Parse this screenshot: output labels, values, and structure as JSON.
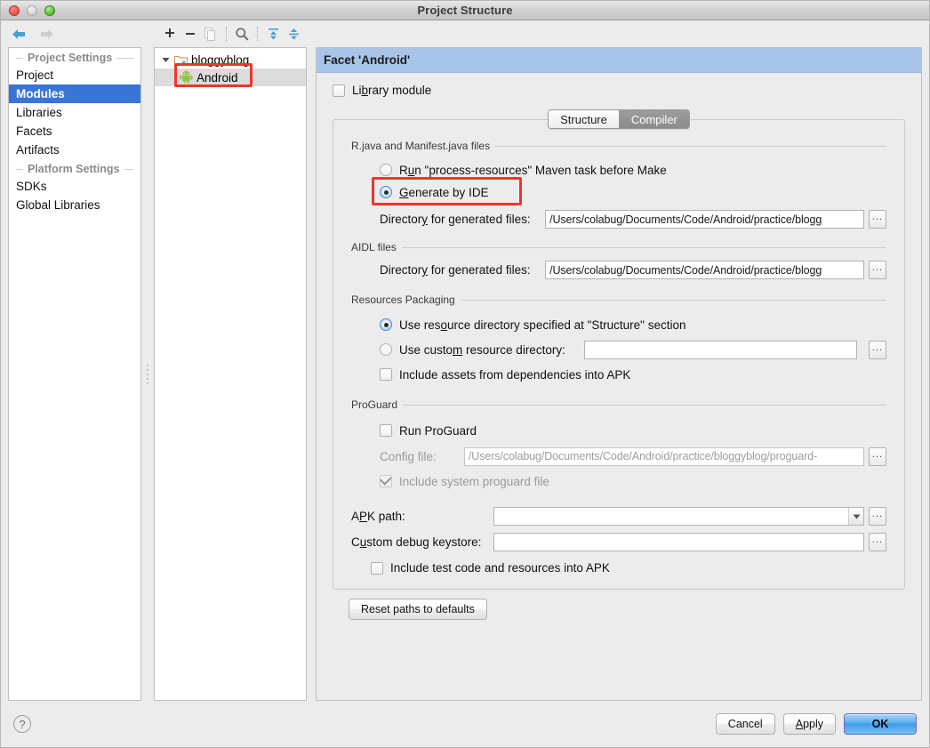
{
  "window": {
    "title": "Project Structure",
    "traffic_lights": [
      "close-red",
      "minimize-yellow",
      "zoom-green"
    ]
  },
  "toolbar": {
    "nav_back": "back-arrow-icon",
    "nav_forward": "forward-arrow-icon",
    "add": "+",
    "remove": "−",
    "copy": "copy-icon",
    "search": "search-icon",
    "expand_all": "expand-all-icon",
    "collapse_all": "collapse-all-icon"
  },
  "sidebar": {
    "groups": [
      {
        "title": "Project Settings",
        "items": [
          {
            "label": "Project",
            "selected": false
          },
          {
            "label": "Modules",
            "selected": true
          },
          {
            "label": "Libraries",
            "selected": false
          },
          {
            "label": "Facets",
            "selected": false
          },
          {
            "label": "Artifacts",
            "selected": false
          }
        ]
      },
      {
        "title": "Platform Settings",
        "items": [
          {
            "label": "SDKs",
            "selected": false
          },
          {
            "label": "Global Libraries",
            "selected": false
          }
        ]
      }
    ]
  },
  "tree": {
    "root": {
      "label": "bloggyblog",
      "expanded": true,
      "icon": "folder-icon"
    },
    "child": {
      "label": "Android",
      "icon": "android-icon",
      "selected": true,
      "highlighted": true
    }
  },
  "main": {
    "header_title": "Facet 'Android'",
    "library_module": {
      "label": "Library module",
      "mnemonic": "b",
      "checked": false
    },
    "tabs": [
      {
        "label": "Structure",
        "active": false
      },
      {
        "label": "Compiler",
        "active": true
      }
    ],
    "sections": [
      {
        "title": "R.java and Manifest.java files",
        "radios": [
          {
            "label": "Run \"process-resources\" Maven task before Make",
            "mnemonic": "u",
            "selected": false,
            "highlighted": false
          },
          {
            "label": "Generate by IDE",
            "mnemonic": "G",
            "selected": true,
            "highlighted": true
          }
        ],
        "field_label": "Directory for generated files:",
        "field_mnemonic": "y",
        "field_value": "/Users/colabug/Documents/Code/Android/practice/blogg",
        "browse": "..."
      },
      {
        "title": "AIDL files",
        "field_label": "Directory for generated files:",
        "field_mnemonic": "y",
        "field_value": "/Users/colabug/Documents/Code/Android/practice/blogg",
        "browse": "..."
      },
      {
        "title": "Resources Packaging",
        "radios": [
          {
            "label": "Use resource directory specified at \"Structure\" section",
            "mnemonic": "o",
            "selected": true
          },
          {
            "label": "Use custom resource directory:",
            "mnemonic": "m",
            "selected": false
          }
        ],
        "custom_dir_value": "",
        "checkbox": {
          "label": "Include assets from dependencies into APK",
          "checked": false
        },
        "browse": "..."
      },
      {
        "title": "ProGuard",
        "run_proguard": {
          "label": "Run ProGuard",
          "checked": false
        },
        "config_label": "Config file:",
        "config_value": "/Users/colabug/Documents/Code/Android/practice/bloggyblog/proguard-",
        "config_disabled": true,
        "include_system": {
          "label": "Include system proguard file",
          "checked": true,
          "disabled": true
        },
        "browse": "..."
      }
    ],
    "apk_path": {
      "label": "APK path:",
      "mnemonic": "P",
      "value": "",
      "browse": "..."
    },
    "keystore": {
      "label": "Custom debug keystore:",
      "mnemonic": "u",
      "value": "",
      "browse": "..."
    },
    "include_test": {
      "label": "Include test code and resources into APK",
      "checked": false
    },
    "reset_button": "Reset paths to defaults"
  },
  "footer": {
    "help": "?",
    "buttons": [
      {
        "label": "Cancel",
        "primary": false,
        "mnemonic": ""
      },
      {
        "label": "Apply",
        "primary": false,
        "mnemonic": "A"
      },
      {
        "label": "OK",
        "primary": true,
        "mnemonic": ""
      }
    ]
  },
  "colors": {
    "header_blue": "#a8c4e8",
    "selection_blue": "#3875d7",
    "highlight_red": "#f0352c",
    "ok_blue": "#5aaeee",
    "android_green": "#8ec641"
  }
}
